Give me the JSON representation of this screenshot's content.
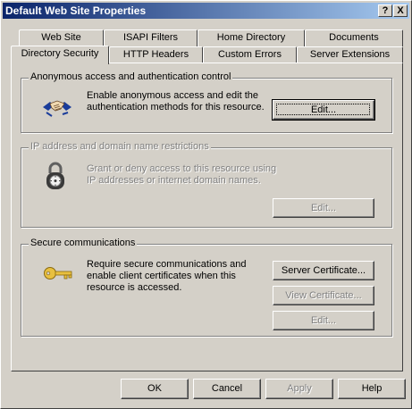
{
  "window": {
    "title": "Default Web Site Properties",
    "help_glyph": "?",
    "close_glyph": "X"
  },
  "tabs": {
    "row_back": [
      "Web Site",
      "ISAPI Filters",
      "Home Directory",
      "Documents"
    ],
    "row_front": [
      "Directory Security",
      "HTTP Headers",
      "Custom Errors",
      "Server Extensions"
    ],
    "selected": "Directory Security"
  },
  "anonymous": {
    "title": "Anonymous access and authentication control",
    "desc_line1": "Enable anonymous access and edit the",
    "desc_line2": "authentication methods for this resource.",
    "edit_label": "Edit...",
    "icon": "handshake-icon"
  },
  "ip_restrictions": {
    "title": "IP address and domain name restrictions",
    "desc_line1": "Grant or deny access to this resource using",
    "desc_line2": "IP addresses or internet domain names.",
    "edit_label": "Edit...",
    "icon": "padlock-icon",
    "enabled": false
  },
  "secure": {
    "title": "Secure communications",
    "desc_line1": "Require secure communications and",
    "desc_line2": "enable client certificates when this",
    "desc_line3": "resource is accessed.",
    "server_cert_label": "Server Certificate...",
    "view_cert_label": "View Certificate...",
    "edit_label": "Edit...",
    "icon": "key-icon"
  },
  "footer": {
    "ok_label": "OK",
    "cancel_label": "Cancel",
    "apply_label": "Apply",
    "help_label": "Help"
  },
  "colors": {
    "face": "#d4d0c8",
    "title_start": "#0a246a",
    "title_end": "#a6caf0",
    "disabled_text": "#808080"
  }
}
